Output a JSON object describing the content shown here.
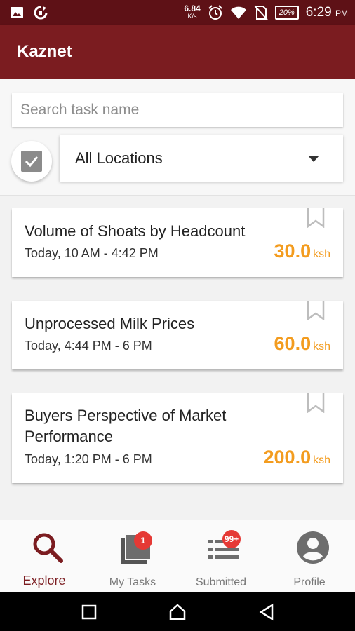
{
  "status_bar": {
    "net_speed": "6.84",
    "net_unit": "K/s",
    "battery": "20%",
    "time": "6:29",
    "ampm": "PM",
    "icons": [
      "image-icon",
      "sync-icon",
      "alarm-icon",
      "wifi-icon",
      "no-sim-icon",
      "battery-icon"
    ]
  },
  "app": {
    "title": "Kaznet",
    "bar_color": "#7b1c20"
  },
  "search": {
    "placeholder": "Search task name",
    "value": ""
  },
  "location_filter": {
    "checked": true,
    "selected": "All Locations"
  },
  "tasks": [
    {
      "title": "Volume of Shoats by Headcount",
      "time": "Today, 10 AM - 4:42 PM",
      "amount": "30.0",
      "unit": "ksh"
    },
    {
      "title": "Unprocessed Milk Prices",
      "time": "Today, 4:44 PM - 6 PM",
      "amount": "60.0",
      "unit": "ksh"
    },
    {
      "title": "Buyers Perspective of Market Performance",
      "time": "Today, 1:20 PM - 6 PM",
      "amount": "200.0",
      "unit": "ksh"
    }
  ],
  "accent_color": "#f39c1f",
  "nav": {
    "explore": "Explore",
    "my_tasks": "My Tasks",
    "my_tasks_badge": "1",
    "submitted": "Submitted",
    "submitted_badge": "99+",
    "profile": "Profile",
    "active": "Explore"
  }
}
